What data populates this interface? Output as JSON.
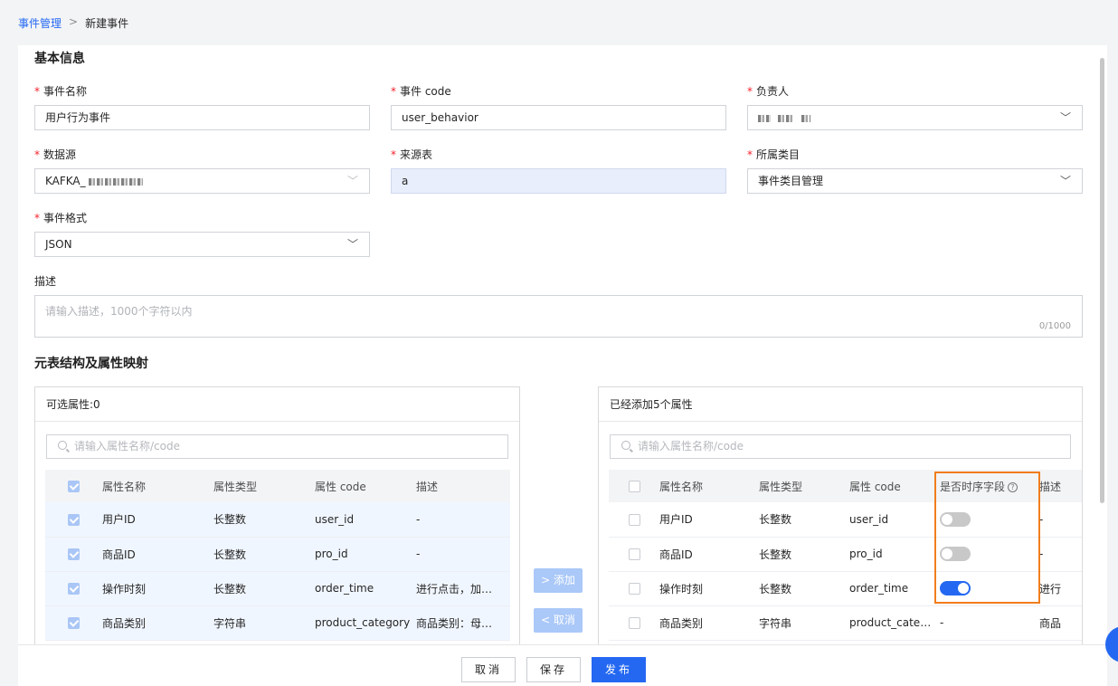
{
  "breadcrumb": {
    "parent": "事件管理",
    "separator": ">",
    "current": "新建事件"
  },
  "basic_info": {
    "title": "基本信息",
    "required_mark": "*",
    "event_name": {
      "label": "事件名称",
      "value": "用户行为事件"
    },
    "event_code": {
      "label": "事件 code",
      "value": "user_behavior"
    },
    "owner": {
      "label": "负责人"
    },
    "datasource": {
      "label": "数据源",
      "value_prefix": "KAFKA_"
    },
    "source_table": {
      "label": "来源表",
      "value": "a"
    },
    "category": {
      "label": "所属类目",
      "value": "事件类目管理"
    },
    "event_format": {
      "label": "事件格式",
      "value": "JSON"
    },
    "description": {
      "label": "描述",
      "placeholder": "请输入描述，1000个字符以内",
      "counter": "0/1000"
    }
  },
  "mapping": {
    "title": "元表结构及属性映射",
    "left_panel": {
      "header": "可选属性:0",
      "search_placeholder": "请输入属性名称/code",
      "columns": [
        "属性名称",
        "属性类型",
        "属性 code",
        "描述"
      ],
      "rows": [
        {
          "name": "用户ID",
          "type": "长整数",
          "code": "user_id",
          "desc": "-"
        },
        {
          "name": "商品ID",
          "type": "长整数",
          "code": "pro_id",
          "desc": "-"
        },
        {
          "name": "操作时刻",
          "type": "长整数",
          "code": "order_time",
          "desc": "进行点击，加…"
        },
        {
          "name": "商品类别",
          "type": "字符串",
          "code": "product_category",
          "desc": "商品类别：母…"
        }
      ]
    },
    "add_button": "> 添加",
    "cancel_button": "< 取消",
    "right_panel": {
      "header": "已经添加5个属性",
      "search_placeholder": "请输入属性名称/code",
      "columns": [
        "属性名称",
        "属性类型",
        "属性 code",
        "是否时序字段",
        "描述"
      ],
      "help_glyph": "?",
      "rows": [
        {
          "name": "用户ID",
          "type": "长整数",
          "code": "user_id",
          "is_time": false,
          "desc": "-"
        },
        {
          "name": "商品ID",
          "type": "长整数",
          "code": "pro_id",
          "is_time": false,
          "desc": "-"
        },
        {
          "name": "操作时刻",
          "type": "长整数",
          "code": "order_time",
          "is_time": true,
          "desc": "进行"
        },
        {
          "name": "商品类别",
          "type": "字符串",
          "code": "product_cate…",
          "is_time": null,
          "time_text": "-",
          "desc": "商品"
        }
      ]
    }
  },
  "footer": {
    "cancel": "取消",
    "save": "保存",
    "publish": "发布"
  },
  "colors": {
    "primary": "#2468f2",
    "highlight": "#f07d1d",
    "required": "#f5222d"
  }
}
